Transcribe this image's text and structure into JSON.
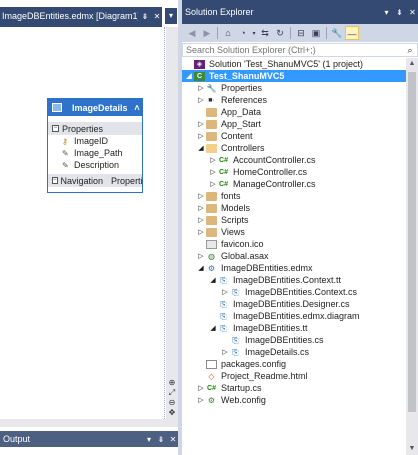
{
  "designer": {
    "tab_title": "ImageDBEntities.edmx [Diagram1]",
    "tab_pin": "⇟",
    "tab_close": "✕",
    "dropdown_arrow": "▾",
    "entity": {
      "name": "ImageDetails",
      "collapse": "˄",
      "properties_label": "Properties",
      "properties": [
        {
          "icon": "key-icon",
          "glyph": "⚷",
          "name": "ImageID"
        },
        {
          "icon": "wrench-icon",
          "glyph": "✎",
          "name": "Image_Path"
        },
        {
          "icon": "wrench-icon",
          "glyph": "✎",
          "name": "Description"
        }
      ],
      "navigation_label": "Navigation",
      "navigation_props": "Properti..."
    },
    "zoom_tools": [
      "⊕",
      "⤢",
      "⊖",
      "✥"
    ]
  },
  "output": {
    "title": "Output",
    "controls": [
      "▾",
      "⇟",
      "✕"
    ]
  },
  "solution_explorer": {
    "title": "Solution Explorer",
    "controls": [
      "▾",
      "⇟",
      "✕"
    ],
    "toolbar": [
      {
        "name": "back-icon",
        "glyph": "◀",
        "dim": true
      },
      {
        "name": "forward-icon",
        "glyph": "▶",
        "dim": true
      },
      {
        "name": "home-icon",
        "glyph": "⌂",
        "dim": false
      },
      {
        "name": "pending-changes-icon",
        "glyph": "◔",
        "dim": false,
        "dropdown": true
      },
      {
        "name": "sync-icon",
        "glyph": "⇆",
        "dim": false
      },
      {
        "name": "refresh-icon",
        "glyph": "↻",
        "dim": false
      },
      {
        "name": "collapse-all-icon",
        "glyph": "⊟",
        "dim": false
      },
      {
        "name": "show-all-files-icon",
        "glyph": "▣",
        "dim": false
      },
      {
        "name": "properties-icon",
        "glyph": "🔧",
        "dim": false
      },
      {
        "name": "preview-icon",
        "glyph": "—",
        "dim": false,
        "pressed": true
      }
    ],
    "search_placeholder": "Search Solution Explorer (Ctrl+;)",
    "search_glyph": "⌕",
    "tree": [
      {
        "level": 0,
        "arrow": "",
        "icon": "sln",
        "glyph": "◈",
        "label": "Solution 'Test_ShanuMVC5' (1 project)"
      },
      {
        "level": 0,
        "arrow": "◢",
        "icon": "csproj",
        "glyph": "C",
        "label": "Test_ShanuMVC5",
        "selected": true
      },
      {
        "level": 1,
        "arrow": "▷",
        "icon": "gear",
        "glyph": "🔧",
        "label": "Properties"
      },
      {
        "level": 1,
        "arrow": "▷",
        "icon": "refs",
        "glyph": "■·",
        "label": "References"
      },
      {
        "level": 1,
        "arrow": "",
        "icon": "folder",
        "glyph": "",
        "label": "App_Data"
      },
      {
        "level": 1,
        "arrow": "▷",
        "icon": "folder",
        "glyph": "",
        "label": "App_Start"
      },
      {
        "level": 1,
        "arrow": "▷",
        "icon": "folder",
        "glyph": "",
        "label": "Content"
      },
      {
        "level": 1,
        "arrow": "◢",
        "icon": "folder open",
        "glyph": "",
        "label": "Controllers"
      },
      {
        "level": 2,
        "arrow": "▷",
        "icon": "cs",
        "glyph": "C#",
        "label": "AccountController.cs"
      },
      {
        "level": 2,
        "arrow": "▷",
        "icon": "cs",
        "glyph": "C#",
        "label": "HomeController.cs"
      },
      {
        "level": 2,
        "arrow": "▷",
        "icon": "cs",
        "glyph": "C#",
        "label": "ManageController.cs"
      },
      {
        "level": 1,
        "arrow": "▷",
        "icon": "folder",
        "glyph": "",
        "label": "fonts"
      },
      {
        "level": 1,
        "arrow": "▷",
        "icon": "folder",
        "glyph": "",
        "label": "Models"
      },
      {
        "level": 1,
        "arrow": "▷",
        "icon": "folder",
        "glyph": "",
        "label": "Scripts"
      },
      {
        "level": 1,
        "arrow": "▷",
        "icon": "folder",
        "glyph": "",
        "label": "Views"
      },
      {
        "level": 1,
        "arrow": "",
        "icon": "ico",
        "glyph": "",
        "label": "favicon.ico"
      },
      {
        "level": 1,
        "arrow": "▷",
        "icon": "globe",
        "glyph": "◍",
        "label": "Global.asax"
      },
      {
        "level": 1,
        "arrow": "◢",
        "icon": "edmx",
        "glyph": "⚙",
        "label": "ImageDBEntities.edmx"
      },
      {
        "level": 2,
        "arrow": "◢",
        "icon": "tt",
        "glyph": "⎘",
        "label": "ImageDBEntities.Context.tt"
      },
      {
        "level": 3,
        "arrow": "▷",
        "icon": "tt",
        "glyph": "⎘",
        "label": "ImageDBEntities.Context.cs"
      },
      {
        "level": 2,
        "arrow": "",
        "icon": "tt",
        "glyph": "⎘",
        "label": "ImageDBEntities.Designer.cs"
      },
      {
        "level": 2,
        "arrow": "",
        "icon": "diagram",
        "glyph": "⎘",
        "label": "ImageDBEntities.edmx.diagram"
      },
      {
        "level": 2,
        "arrow": "◢",
        "icon": "tt",
        "glyph": "⎘",
        "label": "ImageDBEntities.tt"
      },
      {
        "level": 3,
        "arrow": "",
        "icon": "tt",
        "glyph": "⎘",
        "label": "ImageDBEntities.cs"
      },
      {
        "level": 3,
        "arrow": "▷",
        "icon": "tt",
        "glyph": "⎘",
        "label": "ImageDetails.cs"
      },
      {
        "level": 1,
        "arrow": "",
        "icon": "file",
        "glyph": "",
        "label": "packages.config"
      },
      {
        "level": 1,
        "arrow": "",
        "icon": "html",
        "glyph": "◇",
        "label": "Project_Readme.html"
      },
      {
        "level": 1,
        "arrow": "▷",
        "icon": "cs",
        "glyph": "C#",
        "label": "Startup.cs"
      },
      {
        "level": 1,
        "arrow": "▷",
        "icon": "globe",
        "glyph": "⚙",
        "label": "Web.config"
      }
    ],
    "scroll_up": "▲",
    "scroll_down": "▼"
  }
}
